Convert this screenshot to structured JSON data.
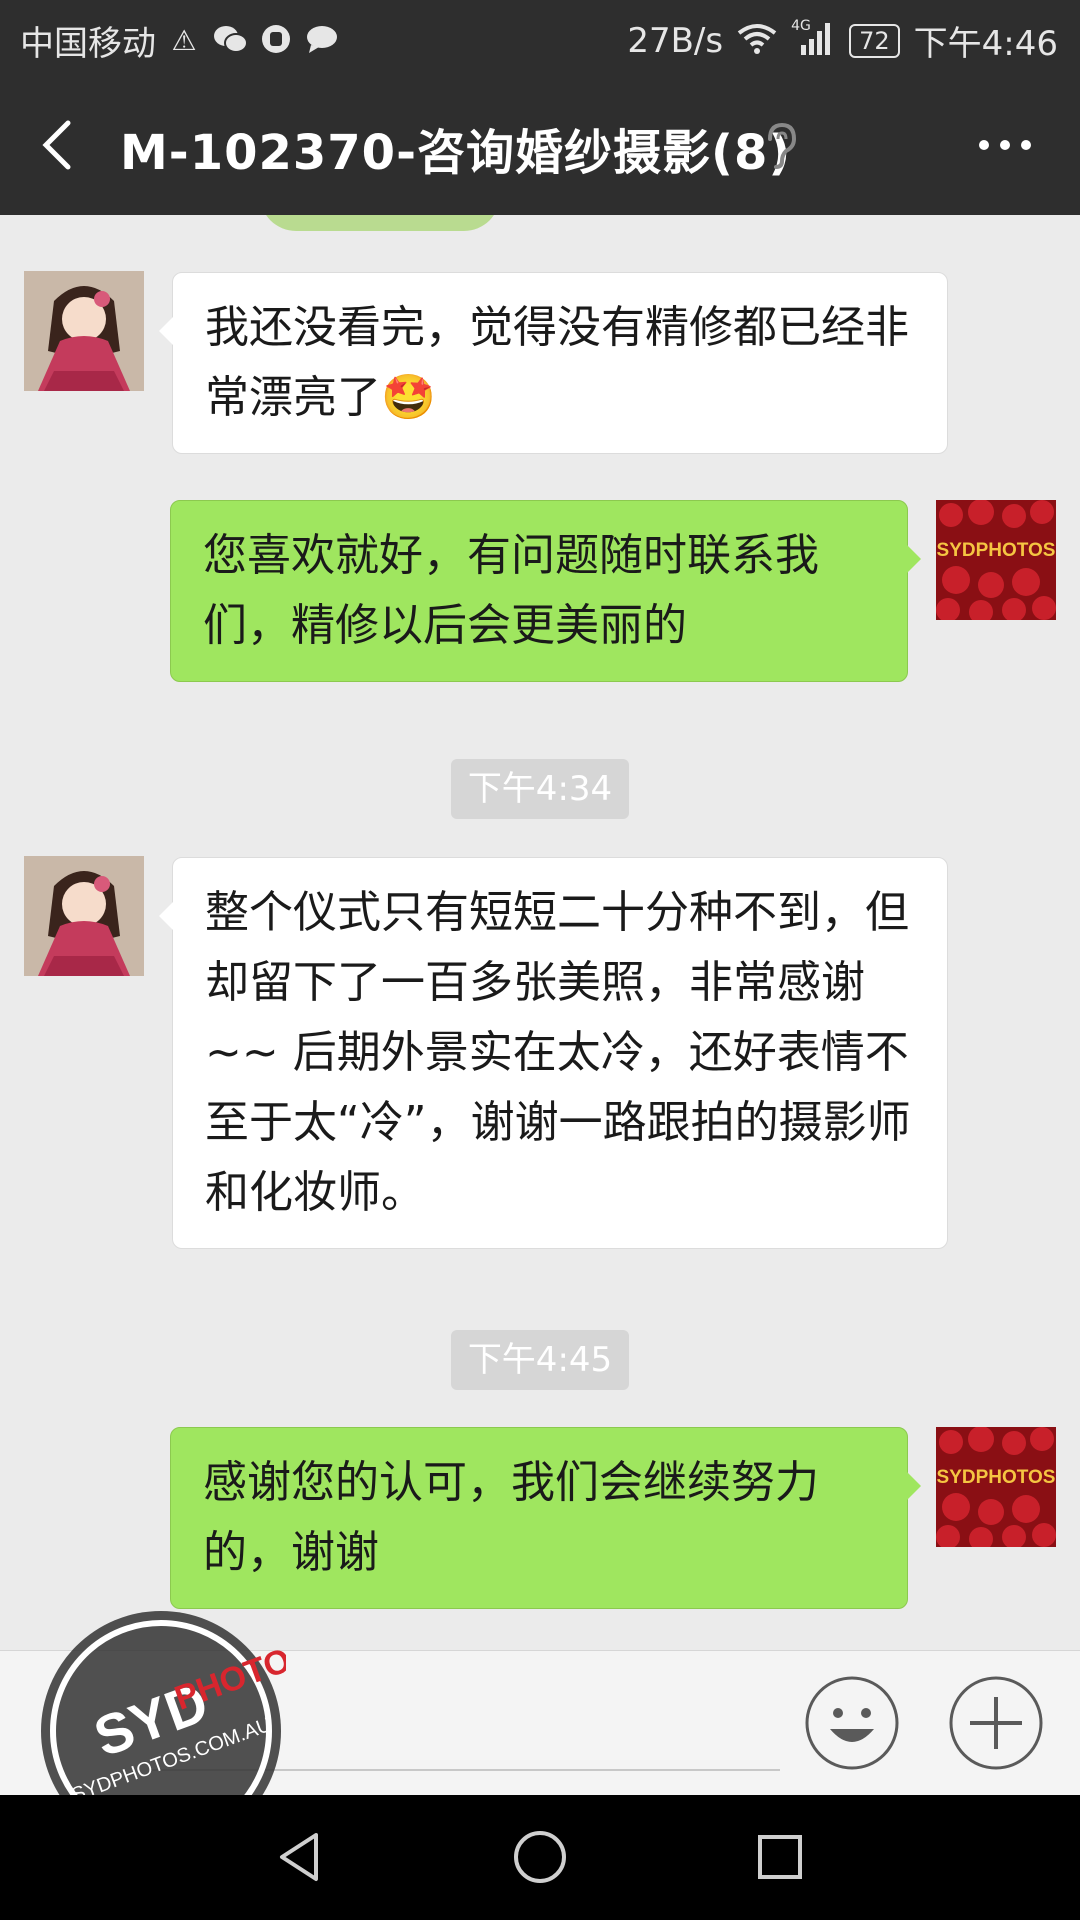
{
  "status_bar": {
    "carrier": "中国移动",
    "speed": "27B/s",
    "network": "4G",
    "battery": "72",
    "time": "下午4:46",
    "icons": [
      "warning-icon",
      "wechat-icon",
      "app-icon",
      "message-icon",
      "wifi-icon",
      "signal-icon"
    ]
  },
  "header": {
    "title": "M-102370-咨询婚纱摄影(8)",
    "back_icon": "back-arrow-icon",
    "ear_icon": "earpiece-mode-icon",
    "more_icon": "more-dots-icon"
  },
  "messages": [
    {
      "side": "in",
      "text": "我还没看完，觉得没有精修都已经非常漂亮了",
      "emoji": "🤩"
    },
    {
      "side": "out",
      "text": "您喜欢就好，有问题随时联系我们，精修以后会更美丽的"
    },
    {
      "type": "time",
      "text": "下午4:34"
    },
    {
      "side": "in",
      "text": "整个仪式只有短短二十分种不到，但却留下了一百多张美照，非常感谢 ~~ 后期外景实在太冷，还好表情不至于太“冷”，谢谢一路跟拍的摄影师和化妆师。"
    },
    {
      "type": "time",
      "text": "下午4:45"
    },
    {
      "side": "out",
      "text": "感谢您的认可，我们会继续努力的，谢谢"
    }
  ],
  "out_avatar_text": "SYDPHOTOS",
  "input_bar": {
    "placeholder": "",
    "emoji_icon": "emoji-icon",
    "plus_icon": "plus-icon"
  },
  "watermark": {
    "brand_a": "SYD",
    "brand_b": "PHOTOS",
    "url": "SYDPHOTOS.COM.AU"
  },
  "nav": {
    "icons": [
      "back-triangle-icon",
      "home-circle-icon",
      "recents-square-icon"
    ]
  },
  "colors": {
    "header_bg": "#2e2e2e",
    "chat_bg": "#ebebeb",
    "out_bubble": "#9fe65f",
    "in_bubble": "#ffffff",
    "watermark_red": "#d8262e"
  }
}
